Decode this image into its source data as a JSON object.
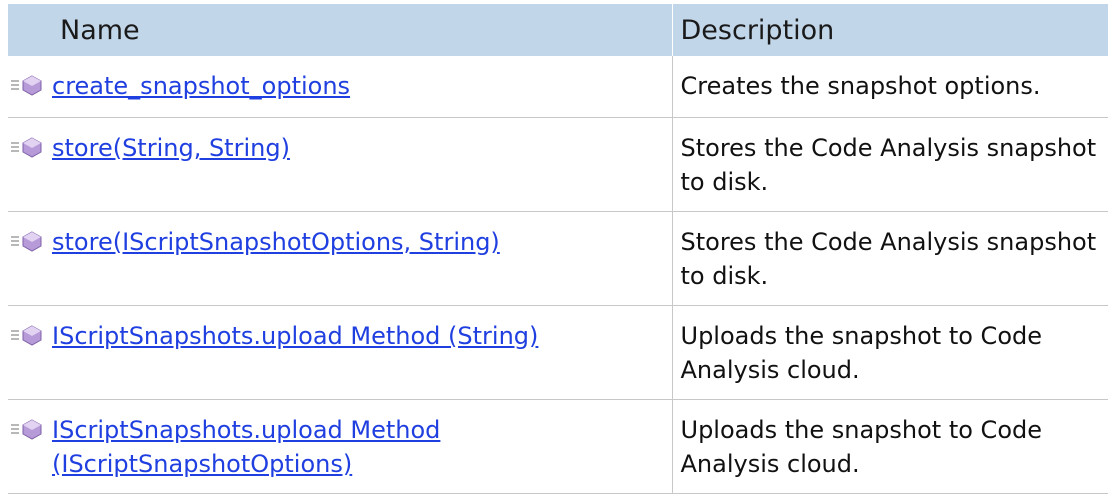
{
  "table": {
    "headers": {
      "name": "Name",
      "description": "Description"
    },
    "rows": [
      {
        "name": "create_snapshot_options",
        "description": "Creates the snapshot options.",
        "icon": "public-method-icon"
      },
      {
        "name": "store(String, String)",
        "description": "Stores the Code Analysis snapshot to disk.",
        "icon": "public-method-icon"
      },
      {
        "name": "store(IScriptSnapshotOptions, String)",
        "description": "Stores the Code Analysis snapshot to disk.",
        "icon": "public-method-icon"
      },
      {
        "name": "IScriptSnapshots.upload Method (String)",
        "description": "Uploads the snapshot to Code Analysis cloud.",
        "icon": "public-method-icon"
      },
      {
        "name": "IScriptSnapshots.upload Method (IScriptSnapshotOptions)",
        "description": "Uploads the snapshot to Code Analysis cloud.",
        "icon": "public-method-icon"
      }
    ]
  },
  "colors": {
    "header_bg": "#c2d6e9",
    "link": "#1f3fe0",
    "icon_purple": "#b79ad8"
  }
}
